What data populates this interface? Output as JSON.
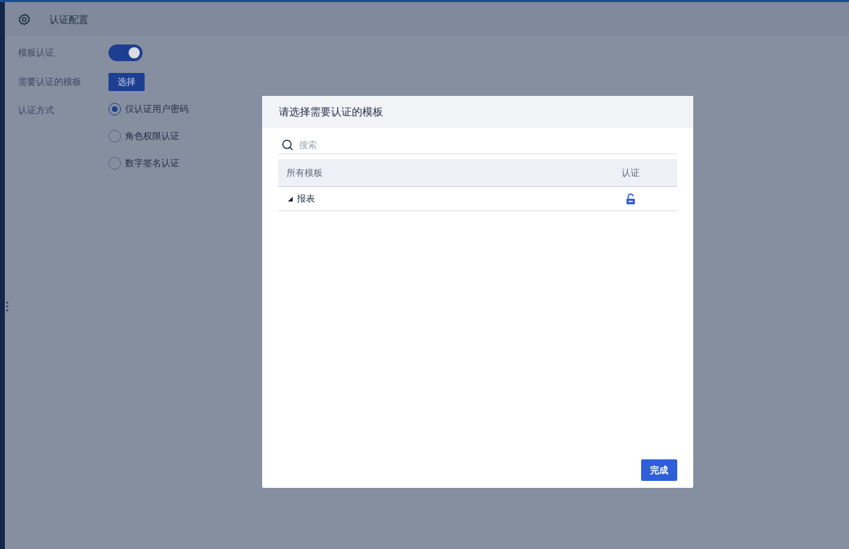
{
  "header": {
    "title": "认证配置"
  },
  "settings": {
    "toggle": {
      "label": "模板认证",
      "on": true
    },
    "templates": {
      "label": "需要认证的模板",
      "button": "选择"
    },
    "method": {
      "label": "认证方式",
      "options": [
        {
          "label": "仅认证用户密码",
          "selected": true
        },
        {
          "label": "角色权限认证",
          "selected": false
        },
        {
          "label": "数字签名认证",
          "selected": false
        }
      ]
    }
  },
  "dialog": {
    "title": "请选择需要认证的模板",
    "search": {
      "placeholder": "搜索"
    },
    "table": {
      "columns": [
        "所有模板",
        "认证"
      ],
      "rows": [
        {
          "name": "报表",
          "expanded": true,
          "locked": false
        }
      ]
    },
    "button": "完成"
  }
}
